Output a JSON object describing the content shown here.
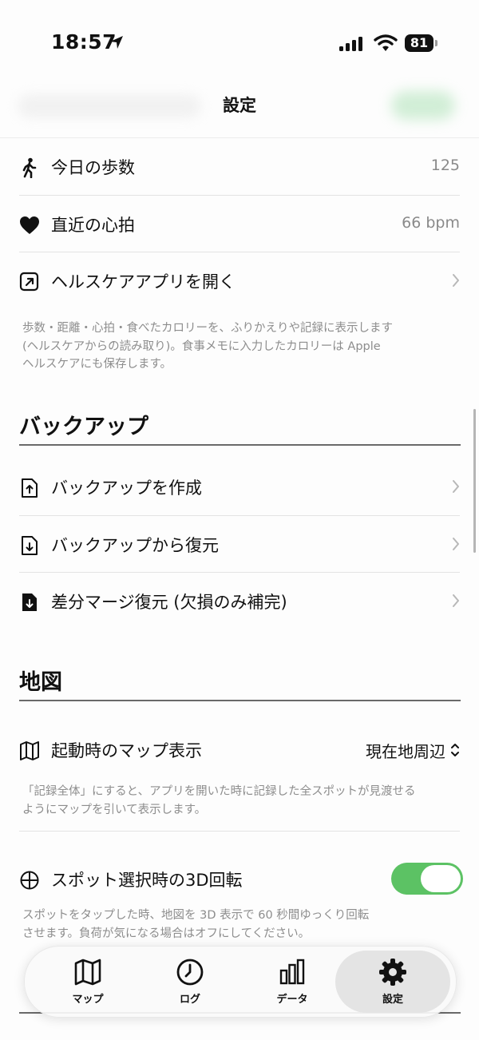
{
  "status_bar": {
    "time": "18:57",
    "battery": "81"
  },
  "nav": {
    "title": "設定"
  },
  "health": {
    "steps_label": "今日の歩数",
    "steps_value": "125",
    "heart_label": "直近の心拍",
    "heart_value": "66 bpm",
    "open_app_label": "ヘルスケアアプリを開く",
    "note_lines": [
      "歩数・距離・心拍・食べたカロリーを、ふりかえりや記録に表示します",
      "(ヘルスケアからの読み取り)。食事メモに入力したカロリーは Apple",
      "ヘルスケアにも保存します。"
    ]
  },
  "backup": {
    "title": "バックアップ",
    "create_label": "バックアップを作成",
    "restore_label": "バックアップから復元",
    "merge_label": "差分マージ復元 (欠損のみ補完)"
  },
  "map": {
    "title": "地図",
    "launch_label": "起動時のマップ表示",
    "launch_value": "現在地周辺",
    "launch_note_lines": [
      "「記録全体」にすると、アプリを開いた時に記録した全スポットが見渡せる",
      "ようにマップを引いて表示します。"
    ],
    "rotate_label": "スポット選択時の3D回転",
    "rotate_enabled": true,
    "rotate_note_lines": [
      "スポットをタップした時、地図を 3D 表示で 60 秒間ゆっくり回転",
      "させます。負荷が気になる場合はオフにしてください。"
    ]
  },
  "tabbar": {
    "tabs": [
      {
        "label": "マップ",
        "icon": "map-icon"
      },
      {
        "label": "ログ",
        "icon": "clock-icon"
      },
      {
        "label": "データ",
        "icon": "chart-icon"
      },
      {
        "label": "設定",
        "icon": "gear-icon",
        "active": true
      }
    ]
  },
  "colors": {
    "toggle_on": "#5cc264",
    "secondary_text": "#8a8a8a"
  }
}
